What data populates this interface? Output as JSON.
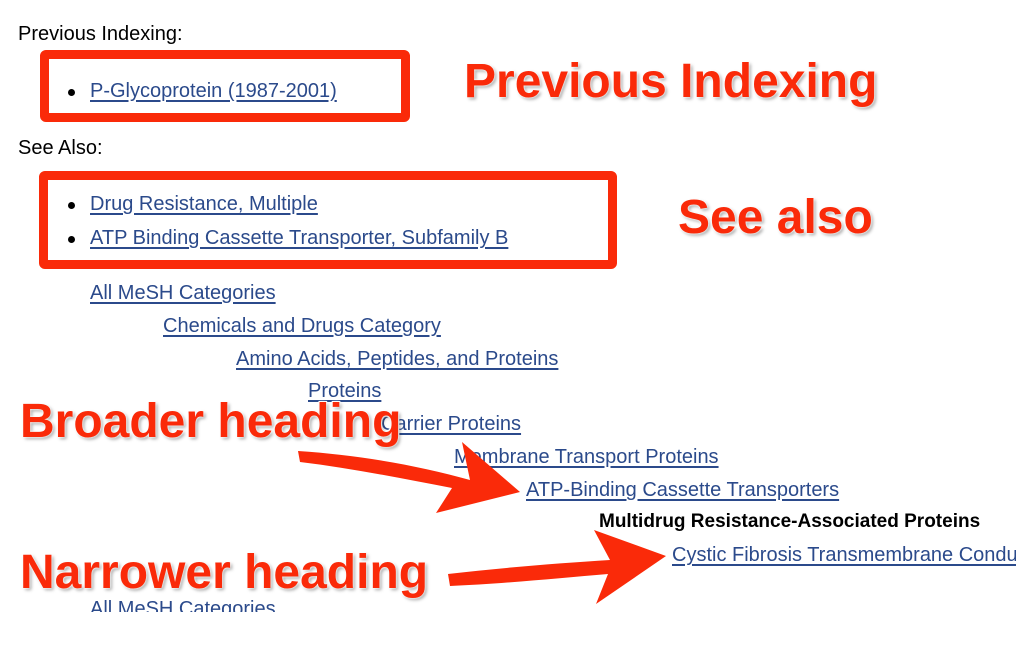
{
  "previous_indexing": {
    "label": "Previous Indexing:",
    "items": [
      "P-Glycoprotein (1987-2001)"
    ]
  },
  "see_also": {
    "label": "See Also:",
    "items": [
      "Drug Resistance, Multiple",
      "ATP Binding Cassette Transporter, Subfamily B"
    ]
  },
  "tree": {
    "items": [
      "All MeSH Categories",
      "Chemicals and Drugs Category",
      "Amino Acids, Peptides, and Proteins",
      "Proteins",
      "Carrier Proteins",
      "Membrane Transport Proteins",
      "ATP-Binding Cassette Transporters"
    ],
    "current": "Multidrug Resistance-Associated Proteins",
    "narrower": "Cystic Fibrosis Transmembrane Conductance Regulator",
    "next_tree_first": "All MeSH Categories"
  },
  "annotations": {
    "previous_indexing": "Previous Indexing",
    "see_also": "See also",
    "broader": "Broader heading",
    "narrower": "Narrower heading",
    "color": "#fa2a09"
  }
}
